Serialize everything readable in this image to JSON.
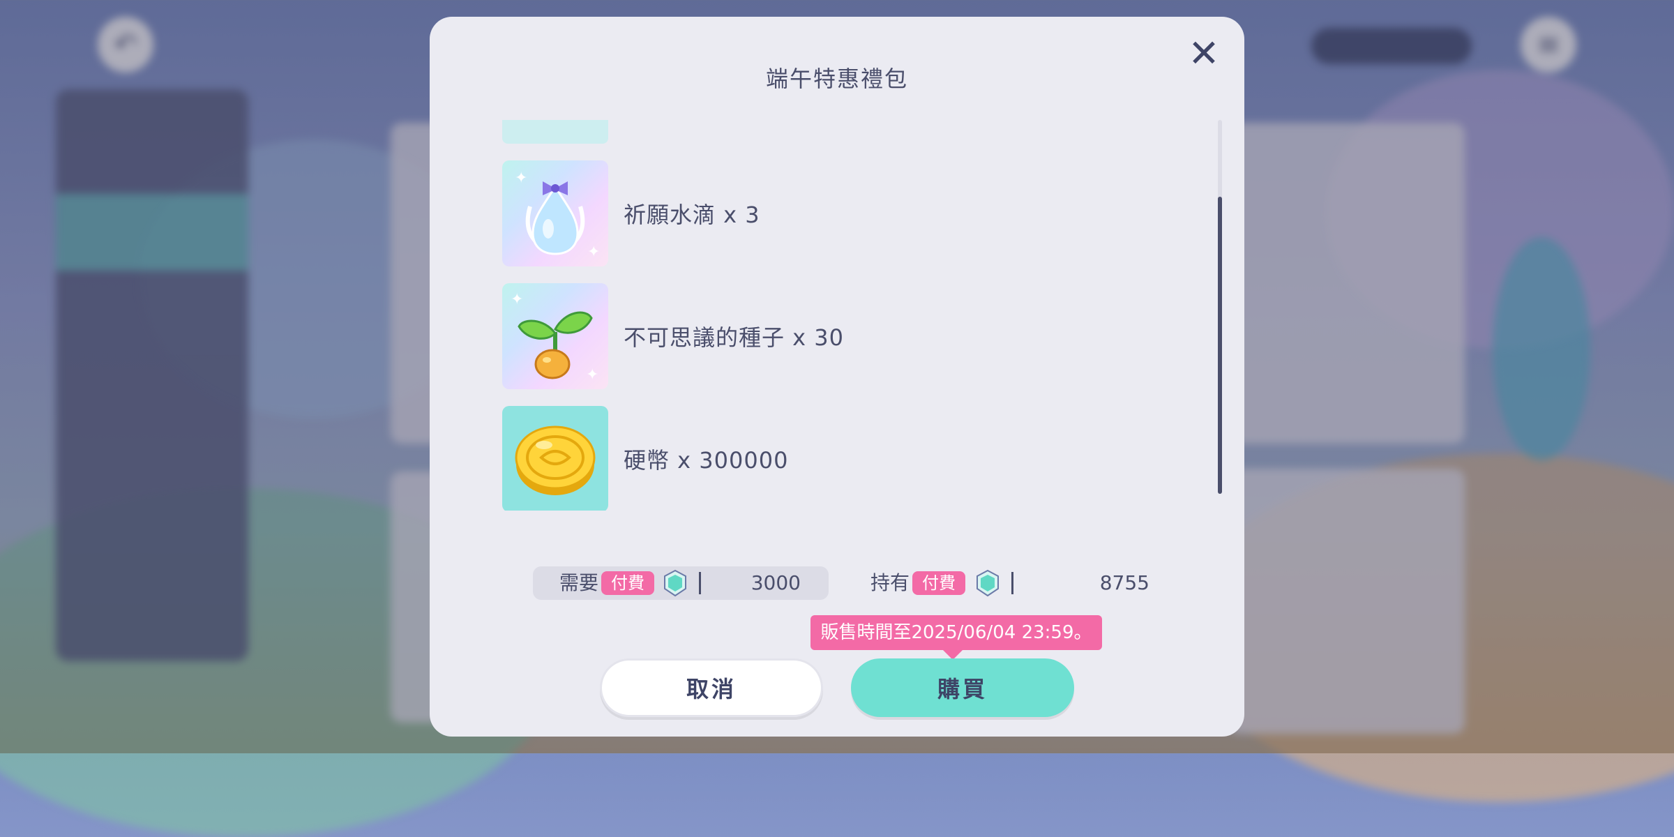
{
  "dialog": {
    "title": "端午特惠禮包",
    "close_icon": "close-icon",
    "items": [
      {
        "label": "祈願水滴 x 3",
        "icon": "wish-water-drop-icon"
      },
      {
        "label": "不可思議的種子 x 30",
        "icon": "seed-sprout-icon"
      },
      {
        "label": "硬幣 x 300000",
        "icon": "coin-icon"
      }
    ],
    "need": {
      "label": "需要",
      "badge": "付費",
      "amount": "3000",
      "icon": "gem-icon"
    },
    "have": {
      "label": "持有",
      "badge": "付費",
      "amount": "8755",
      "icon": "gem-icon"
    },
    "sale_notice": "販售時間至2025/06/04 23:59。",
    "cancel_label": "取消",
    "buy_label": "購買"
  },
  "colors": {
    "accent_teal": "#6fe0d2",
    "accent_pink": "#f36aa6",
    "text_dark": "#4a4e6b",
    "dialog_bg": "#ebebf2"
  }
}
